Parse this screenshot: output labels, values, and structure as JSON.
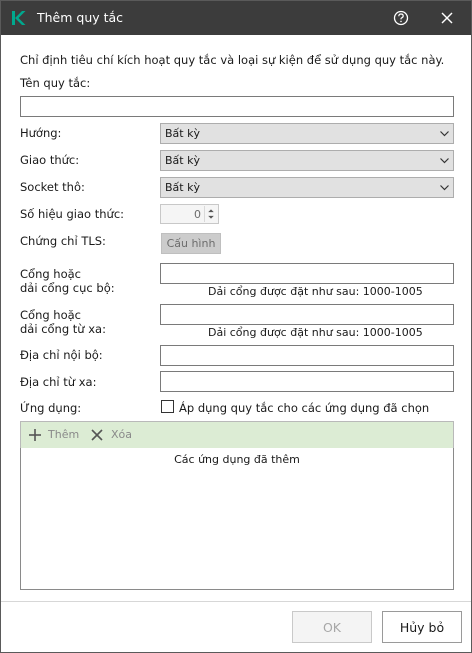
{
  "window": {
    "title": "Thêm quy tắc",
    "description": "Chỉ định tiêu chí kích hoạt quy tắc và loại sự kiện để sử dụng quy tắc này."
  },
  "fields": {
    "rule_name_label": "Tên quy tắc:",
    "rule_name_value": "",
    "direction_label": "Hướng:",
    "direction_value": "Bất kỳ",
    "protocol_label": "Giao thức:",
    "protocol_value": "Bất kỳ",
    "raw_socket_label": "Socket thô:",
    "raw_socket_value": "Bất kỳ",
    "protocol_number_label": "Số hiệu giao thức:",
    "protocol_number_value": "0",
    "tls_label": "Chứng chỉ TLS:",
    "tls_button": "Cấu hình",
    "local_ports_label_1": "Cổng hoặc",
    "local_ports_label_2": "dải cổng cục bộ:",
    "local_ports_value": "",
    "local_ports_hint": "Dải cổng được đặt như sau: 1000-1005",
    "remote_ports_label_1": "Cổng hoặc",
    "remote_ports_label_2": "dải cổng từ xa:",
    "remote_ports_value": "",
    "remote_ports_hint": "Dải cổng được đặt như sau: 1000-1005",
    "local_address_label": "Địa chỉ nội bộ:",
    "local_address_value": "",
    "remote_address_label": "Địa chỉ từ xa:",
    "remote_address_value": "",
    "apps_label": "Ứng dụng:",
    "apps_checkbox_label": "Áp dụng quy tắc cho các ứng dụng đã chọn",
    "apps_checked": false
  },
  "apps_toolbar": {
    "add_label": "Thêm",
    "remove_label": "Xóa"
  },
  "apps_list": {
    "header": "Các ứng dụng đã thêm"
  },
  "footer": {
    "ok_label": "OK",
    "cancel_label": "Hủy bỏ"
  },
  "icons": {
    "logo": "kaspersky-k-icon",
    "help": "help-circle-icon",
    "close": "close-icon",
    "add": "plus-icon",
    "remove": "x-icon",
    "dropdown": "chevron-down-icon",
    "spinner": "spin-arrows-icon"
  },
  "colors": {
    "titlebar": "#3c3c3c",
    "logo_accent": "#00a88e",
    "toolbar_bg": "#dcecd4"
  }
}
